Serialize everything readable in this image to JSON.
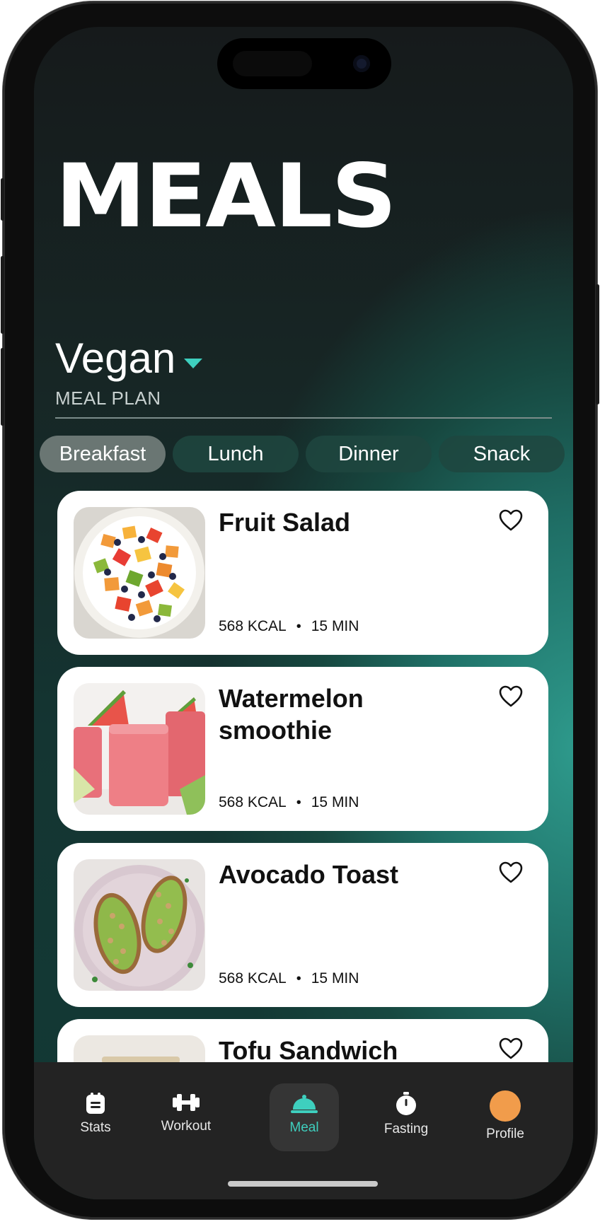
{
  "header": {
    "title": "MEALS"
  },
  "plan": {
    "name": "Vegan",
    "label": "MEAL PLAN"
  },
  "tabs": [
    {
      "label": "Breakfast",
      "active": true
    },
    {
      "label": "Lunch",
      "active": false
    },
    {
      "label": "Dinner",
      "active": false
    },
    {
      "label": "Snack",
      "active": false
    }
  ],
  "meals": [
    {
      "name": "Fruit Salad",
      "kcal": "568 KCAL",
      "separator": "•",
      "time": "15 MIN",
      "image": "fruit-salad-photo",
      "favorited": false
    },
    {
      "name": "Watermelon smoothie",
      "kcal": "568 KCAL",
      "separator": "•",
      "time": "15 MIN",
      "image": "watermelon-smoothie-photo",
      "favorited": false
    },
    {
      "name": "Avocado Toast",
      "kcal": "568 KCAL",
      "separator": "•",
      "time": "15 MIN",
      "image": "avocado-toast-photo",
      "favorited": false
    },
    {
      "name": "Tofu Sandwich",
      "kcal": "",
      "separator": "",
      "time": "",
      "image": "tofu-sandwich-photo",
      "favorited": false
    }
  ],
  "nav": {
    "stats": "Stats",
    "workout": "Workout",
    "meal": "Meal",
    "fasting": "Fasting",
    "profile": "Profile",
    "active": "meal"
  },
  "colors": {
    "accent": "#3ecfbe",
    "avatar": "#f19c4b",
    "tab_active": "#6a7673",
    "tab_inactive": "#1e4640",
    "tabbar": "#232323"
  }
}
